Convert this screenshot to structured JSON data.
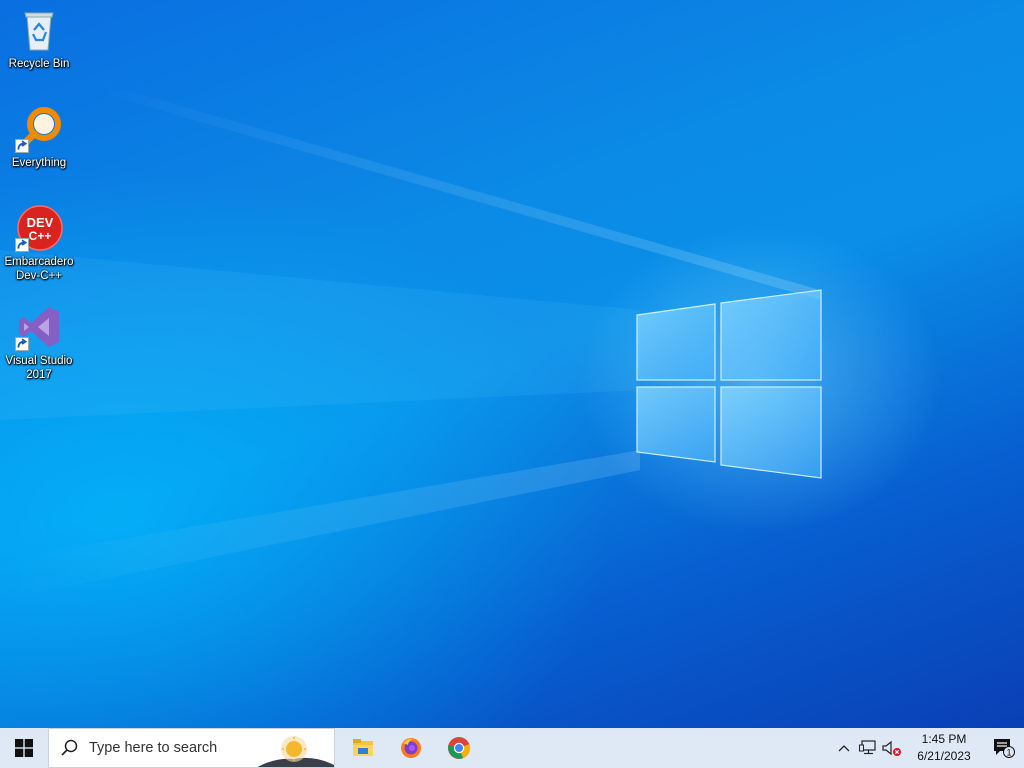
{
  "desktop": {
    "icons": [
      {
        "label": "Recycle Bin"
      },
      {
        "label": "Everything"
      },
      {
        "label": "Embarcadero Dev-C++"
      },
      {
        "label": "Visual Studio 2017"
      }
    ]
  },
  "taskbar": {
    "search_placeholder": "Type here to search",
    "pinned_apps": [
      "file-explorer-icon",
      "firefox-icon",
      "chrome-icon"
    ],
    "tray": {
      "time": "1:45 PM",
      "date": "6/21/2023",
      "notification_count": "1"
    }
  }
}
